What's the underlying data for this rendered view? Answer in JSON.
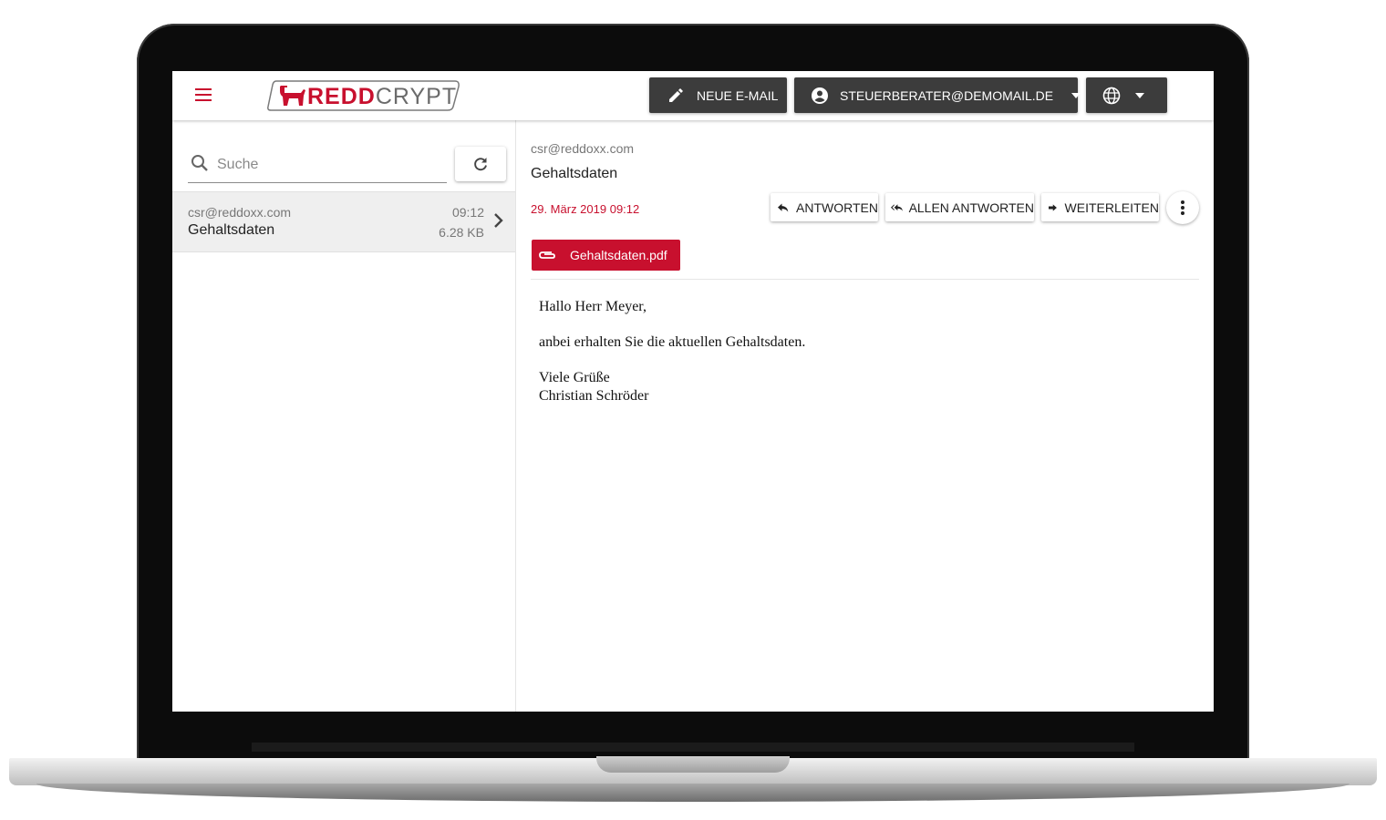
{
  "header": {
    "logo_red": "REDD",
    "logo_gray": "CRYPT",
    "new_mail_label": "NEUE E-MAIL",
    "account_label": "STEUERBERATER@DEMOMAIL.DE"
  },
  "sidebar": {
    "search_placeholder": "Suche",
    "mails": [
      {
        "from": "csr@reddoxx.com",
        "subject": "Gehaltsdaten",
        "time": "09:12",
        "size": "6.28 KB"
      }
    ]
  },
  "message": {
    "from": "csr@reddoxx.com",
    "subject": "Gehaltsdaten",
    "date": "29. März 2019 09:12",
    "reply_label": "ANTWORTEN",
    "reply_all_label": "ALLEN ANTWORTEN",
    "forward_label": "WEITERLEITEN",
    "attachment": "Gehaltsdaten.pdf",
    "body": {
      "greeting": "Hallo Herr Meyer,",
      "line1": "anbei erhalten Sie die aktuellen Gehaltsdaten.",
      "closing": "Viele Grüße",
      "signature": "Christian Schröder"
    }
  },
  "colors": {
    "brand_red": "#c8102e",
    "dark_button": "#3c3c3c"
  }
}
